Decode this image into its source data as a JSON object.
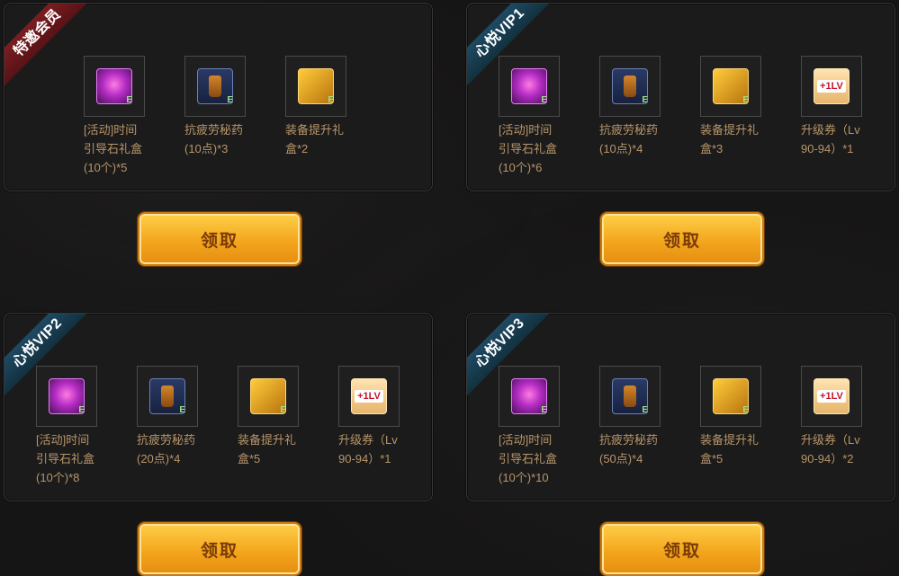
{
  "tiers": [
    {
      "ribbon": "特邀会员",
      "items": [
        {
          "label": "[活动]时间引导石礼盒(10个)*5",
          "icon": "stone-gift-box-icon"
        },
        {
          "label": "抗疲劳秘药(10点)*3",
          "icon": "fatigue-potion-icon"
        },
        {
          "label": "装备提升礼盒*2",
          "icon": "equipment-chest-icon"
        }
      ],
      "button": "领取"
    },
    {
      "ribbon": "心悦VIP1",
      "items": [
        {
          "label": "[活动]时间引导石礼盒(10个)*6",
          "icon": "stone-gift-box-icon"
        },
        {
          "label": "抗疲劳秘药(10点)*4",
          "icon": "fatigue-potion-icon"
        },
        {
          "label": "装备提升礼盒*3",
          "icon": "equipment-chest-icon"
        },
        {
          "label": "升级券（Lv90-94）*1",
          "icon": "level-up-ticket-icon"
        }
      ],
      "button": "领取"
    },
    {
      "ribbon": "心悦VIP2",
      "items": [
        {
          "label": "[活动]时间引导石礼盒(10个)*8",
          "icon": "stone-gift-box-icon"
        },
        {
          "label": "抗疲劳秘药(20点)*4",
          "icon": "fatigue-potion-icon"
        },
        {
          "label": "装备提升礼盒*5",
          "icon": "equipment-chest-icon"
        },
        {
          "label": "升级券（Lv90-94）*1",
          "icon": "level-up-ticket-icon"
        }
      ],
      "button": "领取"
    },
    {
      "ribbon": "心悦VIP3",
      "items": [
        {
          "label": "[活动]时间引导石礼盒(10个)*10",
          "icon": "stone-gift-box-icon"
        },
        {
          "label": "抗疲劳秘药(50点)*4",
          "icon": "fatigue-potion-icon"
        },
        {
          "label": "装备提升礼盒*5",
          "icon": "equipment-chest-icon"
        },
        {
          "label": "升级券（Lv90-94）*2",
          "icon": "level-up-ticket-icon"
        }
      ],
      "button": "领取"
    }
  ],
  "colors": {
    "ribbon_red": "#7a1e22",
    "ribbon_blue": "#1e4a63",
    "label": "#b8956a",
    "button": "#f3a61c"
  }
}
